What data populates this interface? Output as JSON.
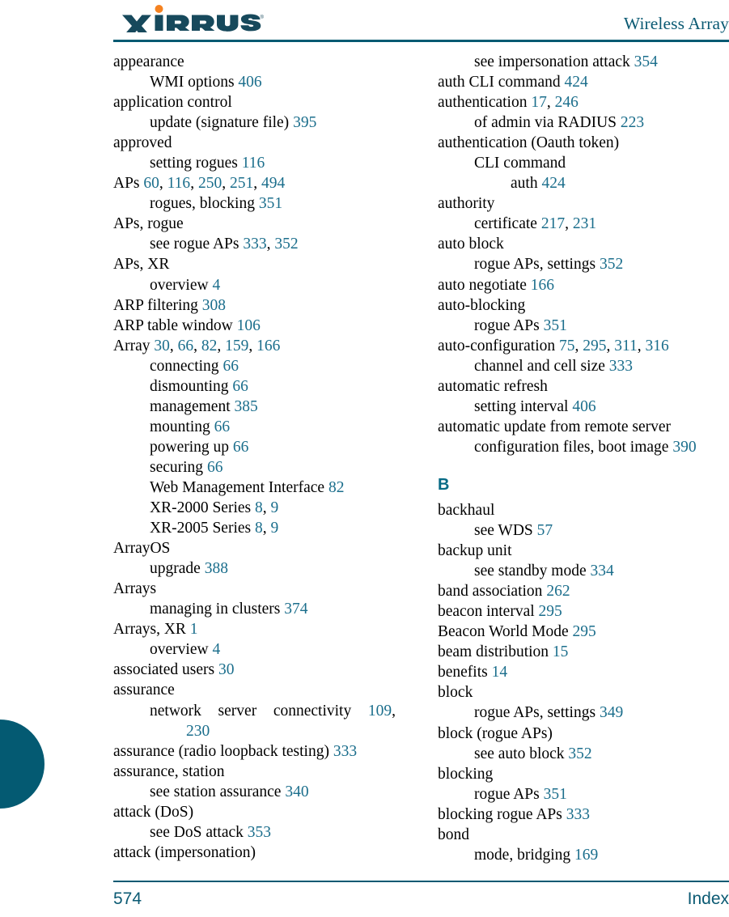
{
  "header": {
    "logo_text": "XIRRUS",
    "logo_trademark": "®",
    "title": "Wireless Array"
  },
  "footer": {
    "page_number": "574",
    "section_label": "Index"
  },
  "colors": {
    "brand_teal": "#045A72",
    "page_number_link": "#1B6E8C",
    "logo_accent_orange": "#F58220"
  },
  "columns": {
    "left": [
      {
        "level": 0,
        "text": "appearance",
        "pages": []
      },
      {
        "level": 1,
        "text": "WMI options",
        "pages": [
          "406"
        ]
      },
      {
        "level": 0,
        "text": "application control",
        "pages": []
      },
      {
        "level": 1,
        "text": "update (signature file)",
        "pages": [
          "395"
        ]
      },
      {
        "level": 0,
        "text": "approved",
        "pages": []
      },
      {
        "level": 1,
        "text": "setting rogues",
        "pages": [
          "116"
        ]
      },
      {
        "level": 0,
        "text": "APs",
        "pages": [
          "60",
          "116",
          "250",
          "251",
          "494"
        ]
      },
      {
        "level": 1,
        "text": "rogues, blocking",
        "pages": [
          "351"
        ]
      },
      {
        "level": 0,
        "text": "APs, rogue",
        "pages": []
      },
      {
        "level": 1,
        "text": "see rogue APs",
        "pages": [
          "333",
          "352"
        ]
      },
      {
        "level": 0,
        "text": "APs, XR",
        "pages": []
      },
      {
        "level": 1,
        "text": "overview",
        "pages": [
          "4"
        ]
      },
      {
        "level": 0,
        "text": "ARP filtering",
        "pages": [
          "308"
        ]
      },
      {
        "level": 0,
        "text": "ARP table window",
        "pages": [
          "106"
        ]
      },
      {
        "level": 0,
        "text": "Array",
        "pages": [
          "30",
          "66",
          "82",
          "159",
          "166"
        ]
      },
      {
        "level": 1,
        "text": "connecting",
        "pages": [
          "66"
        ]
      },
      {
        "level": 1,
        "text": "dismounting",
        "pages": [
          "66"
        ]
      },
      {
        "level": 1,
        "text": "management",
        "pages": [
          "385"
        ]
      },
      {
        "level": 1,
        "text": "mounting",
        "pages": [
          "66"
        ]
      },
      {
        "level": 1,
        "text": "powering up",
        "pages": [
          "66"
        ]
      },
      {
        "level": 1,
        "text": "securing",
        "pages": [
          "66"
        ]
      },
      {
        "level": 1,
        "text": "Web Management Interface",
        "pages": [
          "82"
        ]
      },
      {
        "level": 1,
        "text": "XR-2000 Series",
        "pages": [
          "8",
          "9"
        ]
      },
      {
        "level": 1,
        "text": "XR-2005 Series",
        "pages": [
          "8",
          "9"
        ]
      },
      {
        "level": 0,
        "text": "ArrayOS",
        "pages": []
      },
      {
        "level": 1,
        "text": "upgrade",
        "pages": [
          "388"
        ]
      },
      {
        "level": 0,
        "text": "Arrays",
        "pages": []
      },
      {
        "level": 1,
        "text": "managing in clusters",
        "pages": [
          "374"
        ]
      },
      {
        "level": 0,
        "text": "Arrays, XR",
        "pages": [
          "1"
        ]
      },
      {
        "level": 1,
        "text": "overview",
        "pages": [
          "4"
        ]
      },
      {
        "level": 0,
        "text": "associated users",
        "pages": [
          "30"
        ]
      },
      {
        "level": 0,
        "text": "assurance",
        "pages": []
      },
      {
        "level": 1,
        "wrapped": true,
        "words": [
          "network",
          "server",
          "connectivity"
        ],
        "pages": [
          "109"
        ],
        "continuation_pages": [
          "230"
        ]
      },
      {
        "level": 0,
        "text": "assurance (radio loopback testing)",
        "pages": [
          "333"
        ]
      },
      {
        "level": 0,
        "text": "assurance, station",
        "pages": []
      },
      {
        "level": 1,
        "text": "see station assurance",
        "pages": [
          "340"
        ]
      },
      {
        "level": 0,
        "text": "attack (DoS)",
        "pages": []
      },
      {
        "level": 1,
        "text": "see DoS attack",
        "pages": [
          "353"
        ]
      },
      {
        "level": 0,
        "text": "attack (impersonation)",
        "pages": []
      }
    ],
    "right": [
      {
        "level": 1,
        "text": "see impersonation attack",
        "pages": [
          "354"
        ]
      },
      {
        "level": 0,
        "text": "auth CLI command",
        "pages": [
          "424"
        ]
      },
      {
        "level": 0,
        "text": "authentication",
        "pages": [
          "17",
          "246"
        ]
      },
      {
        "level": 1,
        "text": "of admin via RADIUS",
        "pages": [
          "223"
        ]
      },
      {
        "level": 0,
        "text": "authentication (Oauth token)",
        "pages": []
      },
      {
        "level": 1,
        "text": "CLI command",
        "pages": []
      },
      {
        "level": 2,
        "text": "auth",
        "pages": [
          "424"
        ]
      },
      {
        "level": 0,
        "text": "authority",
        "pages": []
      },
      {
        "level": 1,
        "text": "certificate",
        "pages": [
          "217",
          "231"
        ]
      },
      {
        "level": 0,
        "text": "auto block",
        "pages": []
      },
      {
        "level": 1,
        "text": "rogue APs, settings",
        "pages": [
          "352"
        ]
      },
      {
        "level": 0,
        "text": "auto negotiate",
        "pages": [
          "166"
        ]
      },
      {
        "level": 0,
        "text": "auto-blocking",
        "pages": []
      },
      {
        "level": 1,
        "text": "rogue APs",
        "pages": [
          "351"
        ]
      },
      {
        "level": 0,
        "text": "auto-configuration",
        "pages": [
          "75",
          "295",
          "311",
          "316"
        ]
      },
      {
        "level": 1,
        "text": "channel and cell size",
        "pages": [
          "333"
        ]
      },
      {
        "level": 0,
        "text": "automatic refresh",
        "pages": []
      },
      {
        "level": 1,
        "text": "setting interval",
        "pages": [
          "406"
        ]
      },
      {
        "level": 0,
        "text": "automatic update from remote server",
        "pages": []
      },
      {
        "level": 1,
        "text": "configuration files, boot image",
        "pages": [
          "390"
        ]
      },
      {
        "level": 0,
        "letter_heading": "B"
      },
      {
        "level": 0,
        "text": "backhaul",
        "pages": []
      },
      {
        "level": 1,
        "text": "see WDS",
        "pages": [
          "57"
        ]
      },
      {
        "level": 0,
        "text": "backup unit",
        "pages": []
      },
      {
        "level": 1,
        "text": "see standby mode",
        "pages": [
          "334"
        ]
      },
      {
        "level": 0,
        "text": "band association",
        "pages": [
          "262"
        ]
      },
      {
        "level": 0,
        "text": "beacon interval",
        "pages": [
          "295"
        ]
      },
      {
        "level": 0,
        "text": "Beacon World Mode",
        "pages": [
          "295"
        ]
      },
      {
        "level": 0,
        "text": "beam distribution",
        "pages": [
          "15"
        ]
      },
      {
        "level": 0,
        "text": "benefits",
        "pages": [
          "14"
        ]
      },
      {
        "level": 0,
        "text": "block",
        "pages": []
      },
      {
        "level": 1,
        "text": "rogue APs, settings",
        "pages": [
          "349"
        ]
      },
      {
        "level": 0,
        "text": "block (rogue APs)",
        "pages": []
      },
      {
        "level": 1,
        "text": "see auto block",
        "pages": [
          "352"
        ]
      },
      {
        "level": 0,
        "text": "blocking",
        "pages": []
      },
      {
        "level": 1,
        "text": "rogue APs",
        "pages": [
          "351"
        ]
      },
      {
        "level": 0,
        "text": "blocking rogue APs",
        "pages": [
          "333"
        ]
      },
      {
        "level": 0,
        "text": "bond",
        "pages": []
      },
      {
        "level": 1,
        "text": "mode, bridging",
        "pages": [
          "169"
        ]
      }
    ]
  }
}
